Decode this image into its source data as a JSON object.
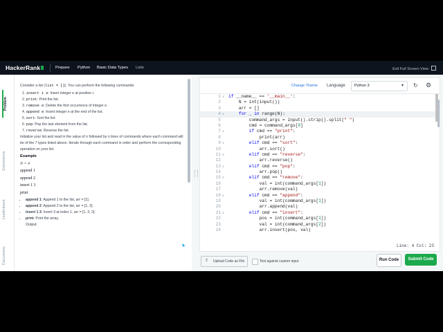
{
  "nav": {
    "logo": "HackerRank",
    "breadcrumbs": [
      "Prepare",
      "Python",
      "Basic Data Types",
      "Lists"
    ],
    "exit_fullscreen": "Exit Full Screen View"
  },
  "side_tabs": [
    "Problem",
    "Submissions",
    "Leaderboard",
    "Discussions"
  ],
  "problem": {
    "intro_a": "Consider a list (",
    "intro_code": "list = []",
    "intro_b": "). You can perform the following commands:",
    "commands": [
      {
        "code": "insert i e",
        "desc": ": Insert integer e at position i."
      },
      {
        "code": "print",
        "desc": ": Print the list."
      },
      {
        "code": "remove e",
        "desc": ": Delete the first occurrence of integer e."
      },
      {
        "code": "append e",
        "desc": ": Insert integer e at the end of the list."
      },
      {
        "code": "sort",
        "desc": ": Sort the list."
      },
      {
        "code": "pop",
        "desc": ": Pop the last element from the list."
      },
      {
        "code": "reverse",
        "desc": ": Reverse the list."
      }
    ],
    "init_text": "Initialize your list and read in the value of n followed by n lines of commands where each command will be of the 7 types listed above. Iterate through each command in order and perform the corresponding operation on your list.",
    "example_heading": "Example",
    "example_n": "N = 4",
    "example_lines": [
      "append 1",
      "append 2",
      "insert 1 3",
      "print"
    ],
    "bullets": [
      {
        "bold": "append 1",
        "text": ": Append 1 to the list, arr = [1]."
      },
      {
        "bold": "append 2",
        "text": ": Append 2 to the list, arr = [1, 2]."
      },
      {
        "bold": "insert 1 3",
        "text": ": Insert 3 at index 1, arr = [1, 3, 2]."
      },
      {
        "bold": "print",
        "text": ": Print the array."
      }
    ],
    "output_label": "Output:"
  },
  "editor": {
    "change_theme": "Change Theme",
    "language_label": "Language",
    "language_value": "Python 3",
    "status": "Line: 4  Col: 23",
    "code_lines": [
      {
        "n": "1",
        "fold": "v",
        "t": "if __name__ == '__main__':"
      },
      {
        "n": "2",
        "fold": "",
        "t": "    N = int(input())"
      },
      {
        "n": "3",
        "fold": "",
        "t": "    arr = []"
      },
      {
        "n": "4",
        "fold": "v",
        "t": "    for _ in range(N):"
      },
      {
        "n": "5",
        "fold": "",
        "t": "        command_args = input().strip().split(\" \")"
      },
      {
        "n": "6",
        "fold": "",
        "t": "        cmd = command_args[0]"
      },
      {
        "n": "7",
        "fold": "v",
        "t": "        if cmd == \"print\":"
      },
      {
        "n": "8",
        "fold": "",
        "t": "            print(arr)"
      },
      {
        "n": "9",
        "fold": "v",
        "t": "        elif cmd == \"sort\":"
      },
      {
        "n": "10",
        "fold": "",
        "t": "            arr.sort()"
      },
      {
        "n": "11",
        "fold": "v",
        "t": "        elif cmd == \"reverse\":"
      },
      {
        "n": "12",
        "fold": "",
        "t": "            arr.reverse()"
      },
      {
        "n": "13",
        "fold": "v",
        "t": "        elif cmd == \"pop\":"
      },
      {
        "n": "14",
        "fold": "",
        "t": "            arr.pop()"
      },
      {
        "n": "15",
        "fold": "v",
        "t": "        elif cmd == \"remove\":"
      },
      {
        "n": "16",
        "fold": "",
        "t": "            val = int(command_args[1])"
      },
      {
        "n": "17",
        "fold": "",
        "t": "            arr.remove(val)"
      },
      {
        "n": "18",
        "fold": "v",
        "t": "        elif cmd == \"append\":"
      },
      {
        "n": "19",
        "fold": "",
        "t": "            val = int(command_args[1])"
      },
      {
        "n": "20",
        "fold": "",
        "t": "            arr.append(val)"
      },
      {
        "n": "21",
        "fold": "v",
        "t": "        elif cmd == \"insert\":"
      },
      {
        "n": "22",
        "fold": "",
        "t": "            pos = int(command_args[1])"
      },
      {
        "n": "23",
        "fold": "",
        "t": "            val = int(command_args[2])"
      },
      {
        "n": "24",
        "fold": "",
        "t": "            arr.insert(pos, val)"
      }
    ]
  },
  "actions": {
    "upload": "Upload Code as File",
    "custom_input": "Test against custom input",
    "run": "Run Code",
    "submit": "Submit Code"
  },
  "colors": {
    "accent": "#1ba94c",
    "nav_bg": "#0e141e",
    "link": "#1a6ed8"
  }
}
